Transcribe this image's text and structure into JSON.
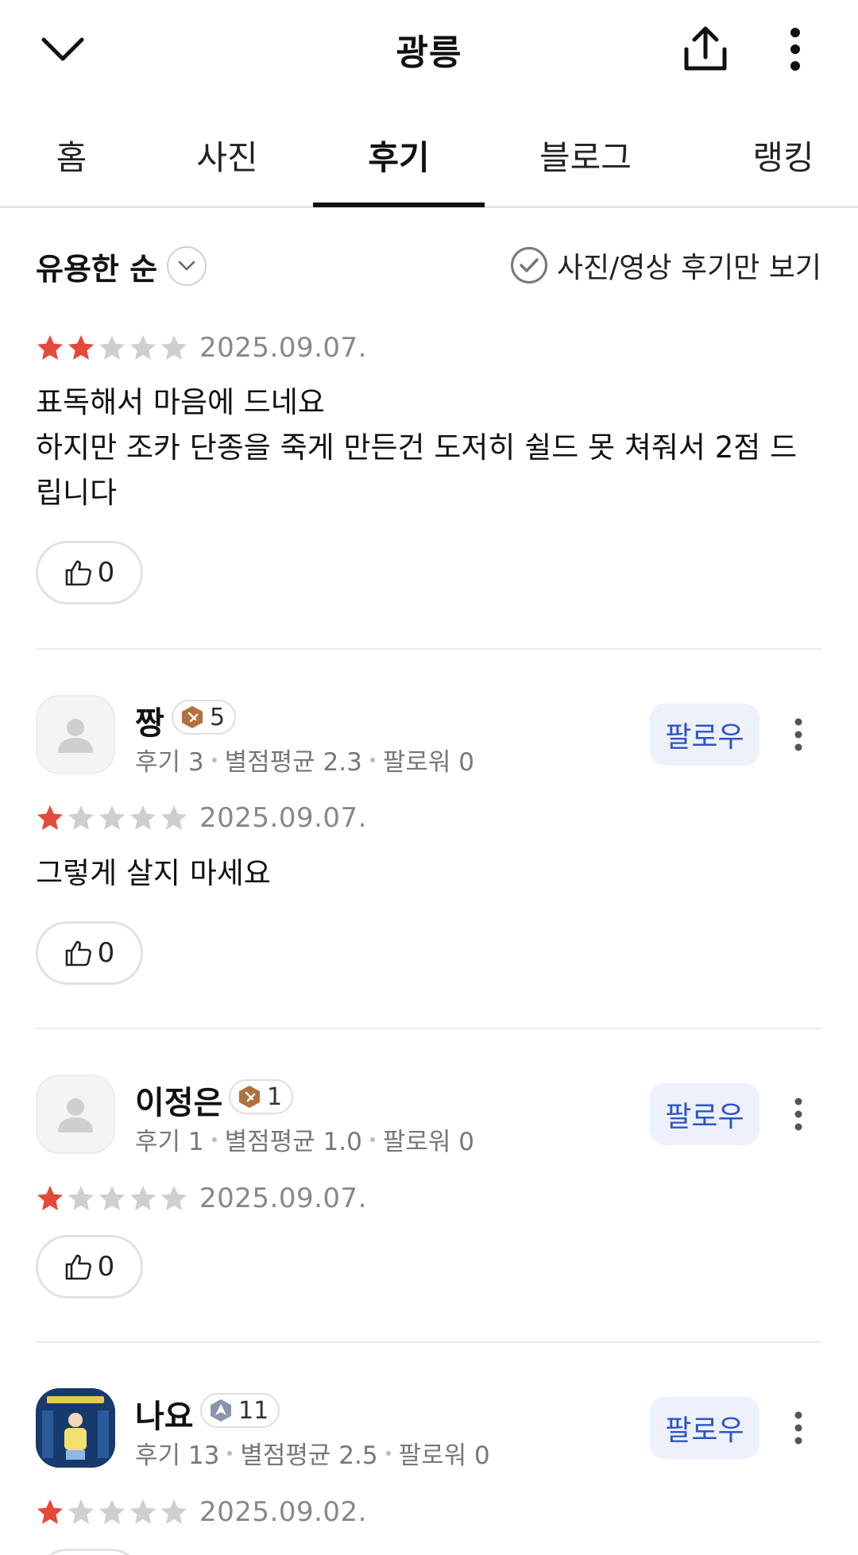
{
  "header": {
    "title": "광릉",
    "back_icon": "chevron-down-icon",
    "share_icon": "share-icon",
    "more_icon": "more-vertical-icon"
  },
  "tabs": [
    {
      "label": "홈",
      "active": false
    },
    {
      "label": "사진",
      "active": false
    },
    {
      "label": "후기",
      "active": true
    },
    {
      "label": "블로그",
      "active": false
    },
    {
      "label": "랭킹",
      "active": false
    }
  ],
  "filter": {
    "sort_label": "유용한 순",
    "photo_only_label": "사진/영상 후기만 보기"
  },
  "colors": {
    "star_filled": "#e5493a",
    "star_empty": "#cfcfcf",
    "follow_text": "#2c56c6",
    "follow_bg": "#eef1fb"
  },
  "reviews": [
    {
      "rating": 2,
      "date": "2025.09.07.",
      "text": "표독해서 마음에 드네요\n하지만 조카 단종을 죽게 만든건 도저히 쉴드 못 쳐줘서 2점 드\n립니다",
      "likes": "0"
    },
    {
      "user": {
        "name": "짱",
        "level": "5",
        "reviews": "후기 3",
        "avg": "별점평균 2.3",
        "followers": "팔로워 0"
      },
      "follow_label": "팔로우",
      "rating": 1,
      "date": "2025.09.07.",
      "text": "그렇게 살지 마세요",
      "likes": "0"
    },
    {
      "user": {
        "name": "이정은",
        "level": "1",
        "reviews": "후기 1",
        "avg": "별점평균 1.0",
        "followers": "팔로워 0"
      },
      "follow_label": "팔로우",
      "rating": 1,
      "date": "2025.09.07.",
      "likes": "0"
    },
    {
      "user": {
        "name": "나요",
        "level": "11",
        "reviews": "후기 13",
        "avg": "별점평균 2.5",
        "followers": "팔로워 0"
      },
      "follow_label": "팔로우",
      "rating": 1,
      "date": "2025.09.02."
    }
  ]
}
